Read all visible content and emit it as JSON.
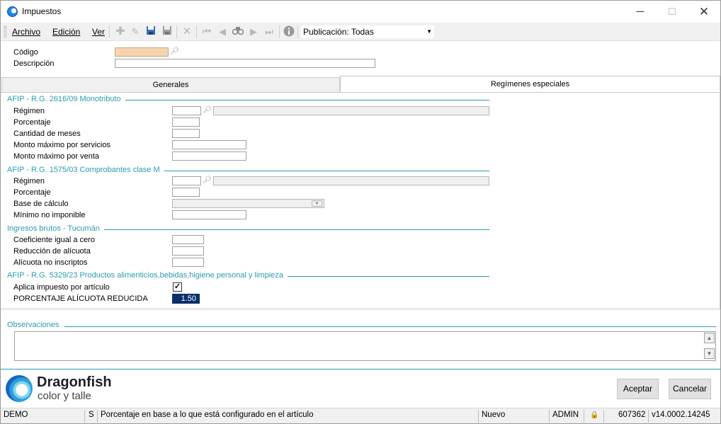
{
  "window": {
    "title": "Impuestos",
    "minimize": "─",
    "maximize": "☐",
    "close": "✕"
  },
  "menu": {
    "archivo": "Archivo",
    "edicion": "Edición",
    "ver": "Ver"
  },
  "toolbar": {
    "icons": [
      "add-icon",
      "edit-icon",
      "save-icon",
      "save-as-icon",
      "delete-icon",
      "first-record-icon",
      "previous-record-icon",
      "find-icon",
      "next-record-icon",
      "last-record-icon",
      "info-icon"
    ],
    "publicacion": "Publicación: Todas"
  },
  "header": {
    "codigo_label": "Código",
    "descripcion_label": "Descripción",
    "codigo_value": "",
    "descripcion_value": ""
  },
  "tabs": [
    {
      "label": "Generales",
      "active": false
    },
    {
      "label": "Regímenes especiales",
      "active": true
    }
  ],
  "sections": {
    "monotributo": {
      "title": "AFIP - R.G. 2616/09 Monotributo",
      "regimen": "Régimen",
      "porcentaje": "Porcentaje",
      "cantidad_meses": "Cantidad de meses",
      "monto_servicios": "Monto máximo por servicios",
      "monto_venta": "Monto máximo por venta"
    },
    "clase_m": {
      "title": "AFIP - R.G. 1575/03 Comprobantes clase M",
      "regimen": "Régimen",
      "porcentaje": "Porcentaje",
      "base_calculo": "Base de cálculo",
      "minimo": "Mínimo no imponible"
    },
    "tucuman": {
      "title": "Ingresos brutos - Tucumán",
      "coeficiente": "Coeficiente igual a cero",
      "reduccion": "Reducción de alícuota",
      "alicuota_no_inscriptos": "Alícuota no inscriptos"
    },
    "alimenticios": {
      "title": "AFIP - R.G. 5329/23 Productos alimenticios,bebidas,higiene personal y limpieza",
      "aplica": "Aplica impuesto por artículo",
      "aplica_checked": true,
      "porcentaje_reducida": "PORCENTAJE ALÍCUOTA REDUCIDA",
      "porcentaje_reducida_value": "1.50"
    }
  },
  "observaciones": {
    "title": "Observaciones",
    "value": ""
  },
  "brand": {
    "name": "Dragonfish",
    "tagline": "color y talle"
  },
  "buttons": {
    "aceptar": "Aceptar",
    "cancelar": "Cancelar"
  },
  "status": {
    "env": "DEMO",
    "mode_flag": "S",
    "message": "Porcentaje en base a lo que está configurado en el artículo",
    "state": "Nuevo",
    "user": "ADMIN",
    "lock": "🔒",
    "id": "607362",
    "version": "v14.0002.14245"
  },
  "colors": {
    "accent": "#2a9bb0",
    "selection": "#0b2f6b",
    "codigo_bg": "#f7d4b0"
  }
}
